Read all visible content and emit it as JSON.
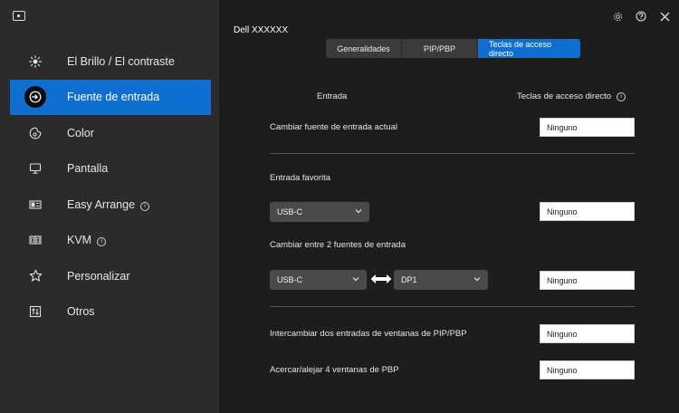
{
  "sidebar": {
    "items": [
      {
        "label": "El Brillo / El contraste",
        "icon": "brightness-icon",
        "info": false
      },
      {
        "label": "Fuente de entrada",
        "icon": "input-source-icon",
        "info": false
      },
      {
        "label": "Color",
        "icon": "color-palette-icon",
        "info": false
      },
      {
        "label": "Pantalla",
        "icon": "display-monitor-icon",
        "info": false
      },
      {
        "label": "Easy Arrange",
        "icon": "easy-arrange-icon",
        "info": true
      },
      {
        "label": "KVM",
        "icon": "kvm-icon",
        "info": true
      },
      {
        "label": "Personalizar",
        "icon": "star-icon",
        "info": false
      },
      {
        "label": "Otros",
        "icon": "others-icon",
        "info": false
      }
    ],
    "active_index": 1
  },
  "header": {
    "device_name": "Dell XXXXXX",
    "icons": [
      "settings-gear-icon",
      "help-icon",
      "close-icon"
    ]
  },
  "tabs": [
    {
      "label": "Generalidades",
      "active": false
    },
    {
      "label": "PIP/PBP",
      "active": false
    },
    {
      "label": "Teclas de acceso directo",
      "active": true
    }
  ],
  "columns": {
    "left": "Entrada",
    "right": "Teclas de acceso directo"
  },
  "rows": {
    "change_current": {
      "label": "Cambiar fuente de entrada actual",
      "hotkey": "Ninguno"
    },
    "favorite_header": "Entrada favorita",
    "favorite": {
      "select": "USB-C",
      "hotkey": "Ninguno"
    },
    "toggle_header": "Cambiar entre 2 fuentes de entrada",
    "toggle": {
      "select_a": "USB-C",
      "select_b": "DP1",
      "hotkey": "Ninguno"
    },
    "swap_pip": {
      "label": "Intercambiar dos entradas de ventanas de PIP/PBP",
      "hotkey": "Ninguno"
    },
    "zoom_pbp": {
      "label": "Acercar/alejar 4 ventanas de PBP",
      "hotkey": "Ninguno"
    }
  },
  "colors": {
    "accent": "#0f6fd1",
    "sidebar_bg": "#2b2b2b",
    "main_bg": "#1d1d1d"
  }
}
